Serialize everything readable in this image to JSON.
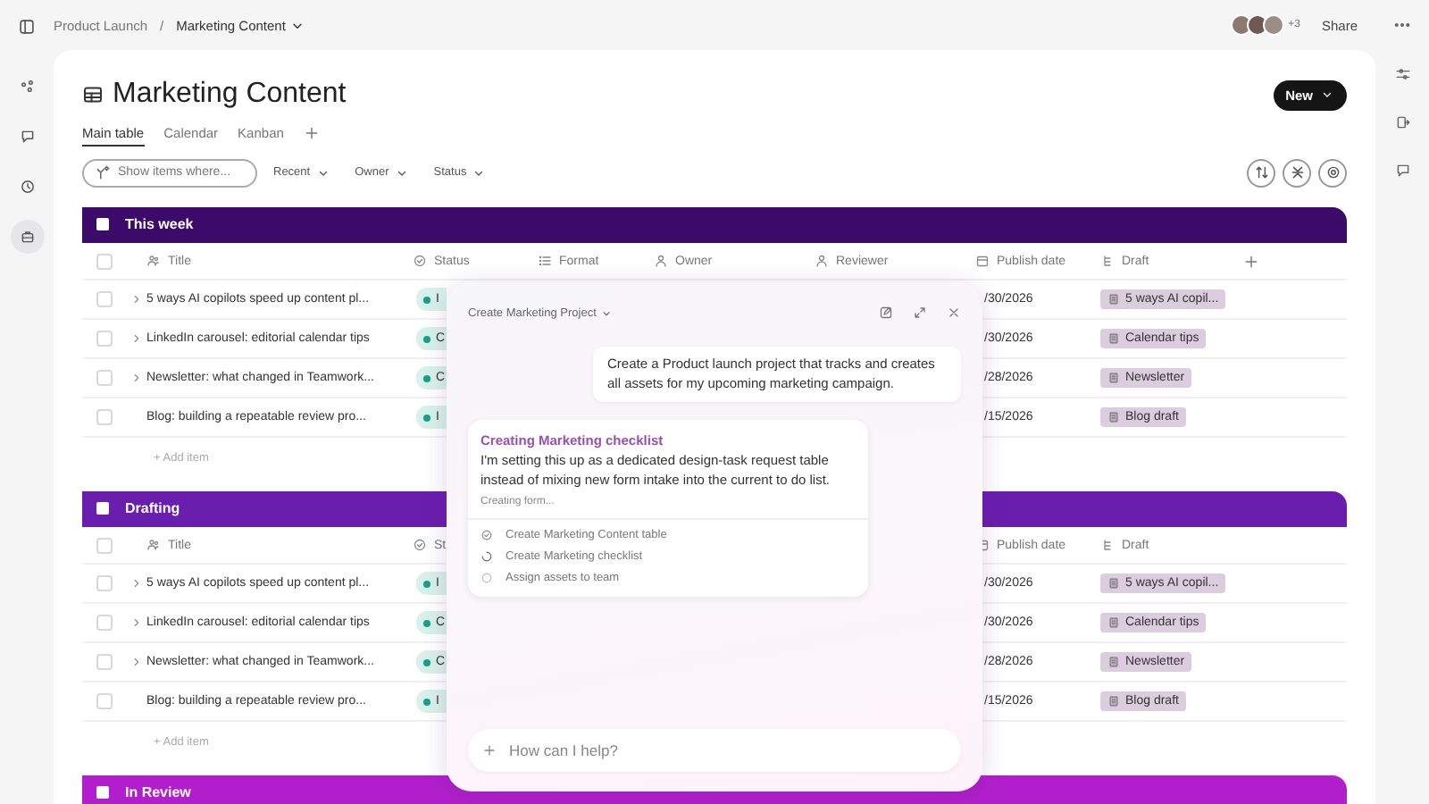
{
  "rail": [
    {
      "selected": false
    },
    {
      "selected": false
    },
    {
      "selected": false
    },
    {
      "selected": true
    }
  ],
  "breadcrumb": {
    "parent": "Product Launch",
    "separator": "/",
    "current": "Marketing Content"
  },
  "collaborators": {
    "extra": "+3"
  },
  "share": "Share",
  "page": {
    "title": "Marketing Content",
    "new_button": "New"
  },
  "tabs": [
    {
      "label": "Main table",
      "selected": true
    },
    {
      "label": "Calendar",
      "selected": false
    },
    {
      "label": "Kanban",
      "selected": false
    }
  ],
  "filter": {
    "placeholder": "Show items where...",
    "dropdowns": [
      "Recent",
      "Owner",
      "Status"
    ]
  },
  "groups": [
    {
      "name": "This week",
      "color": "#3c0a68",
      "header_checked": false,
      "can_add_column": true,
      "columns": [
        {
          "kind": "title",
          "label": "Title"
        },
        {
          "kind": "status",
          "label": "Status"
        },
        {
          "kind": "format",
          "label": "Format"
        },
        {
          "kind": "owner",
          "label": "Owner"
        },
        {
          "kind": "reviewer",
          "label": "Reviewer"
        },
        {
          "kind": "date",
          "label": "Publish date"
        },
        {
          "kind": "draft",
          "label": "Draft"
        }
      ],
      "rows": [
        {
          "checked": false,
          "expandable": true,
          "title": "5 ways AI copilots speed up content pl...",
          "status": "I",
          "date": "/30/2026",
          "draft": "5 ways AI copil..."
        },
        {
          "checked": false,
          "expandable": true,
          "title": "LinkedIn carousel: editorial calendar tips",
          "status": "C",
          "date": "/30/2026",
          "draft": "Calendar tips"
        },
        {
          "checked": false,
          "expandable": true,
          "title": "Newsletter: what changed in Teamwork...",
          "status": "C",
          "date": "/28/2026",
          "draft": "Newsletter"
        },
        {
          "checked": false,
          "expandable": false,
          "title": "Blog: building a repeatable review pro...",
          "status": "I",
          "date": "/15/2026",
          "draft": "Blog draft"
        }
      ],
      "add_item": "+ Add item"
    },
    {
      "name": "Drafting",
      "color": "#6a1eae",
      "header_checked": false,
      "can_add_column": false,
      "columns": [
        {
          "kind": "title",
          "label": "Title"
        },
        {
          "kind": "status",
          "label": "St"
        },
        {
          "kind": "date",
          "label": "Publish date"
        },
        {
          "kind": "draft",
          "label": "Draft"
        }
      ],
      "rows": [
        {
          "checked": false,
          "expandable": true,
          "title": "5 ways AI copilots speed up content pl...",
          "status": "I",
          "date": "/30/2026",
          "draft": "5 ways AI copil..."
        },
        {
          "checked": false,
          "expandable": true,
          "title": "LinkedIn carousel: editorial calendar tips",
          "status": "C",
          "date": "/30/2026",
          "draft": "Calendar tips"
        },
        {
          "checked": false,
          "expandable": true,
          "title": "Newsletter: what changed in Teamwork...",
          "status": "C",
          "date": "/28/2026",
          "draft": "Newsletter"
        },
        {
          "checked": false,
          "expandable": false,
          "title": "Blog: building a repeatable review pro...",
          "status": "I",
          "date": "/15/2026",
          "draft": "Blog draft"
        }
      ],
      "add_item": "+ Add item"
    },
    {
      "name": "In Review",
      "color": "#b11fcc"
    }
  ],
  "assistant": {
    "title": "Create Marketing Project",
    "prompt": "Create a Product launch project that tracks and creates all assets for my upcoming marketing campaign.",
    "reply": {
      "heading": "Creating Marketing checklist",
      "body": "I'm setting this up as a dedicated design-task request table instead of mixing new form intake into the current to do list.",
      "progress": "Creating form...",
      "steps": [
        {
          "label": "Create Marketing Content table",
          "kind": "done"
        },
        {
          "label": "Create Marketing checklist",
          "kind": "active"
        },
        {
          "label": "Assign assets to team",
          "kind": "pending"
        }
      ]
    },
    "input": {
      "placeholder": "How can I help?"
    }
  }
}
